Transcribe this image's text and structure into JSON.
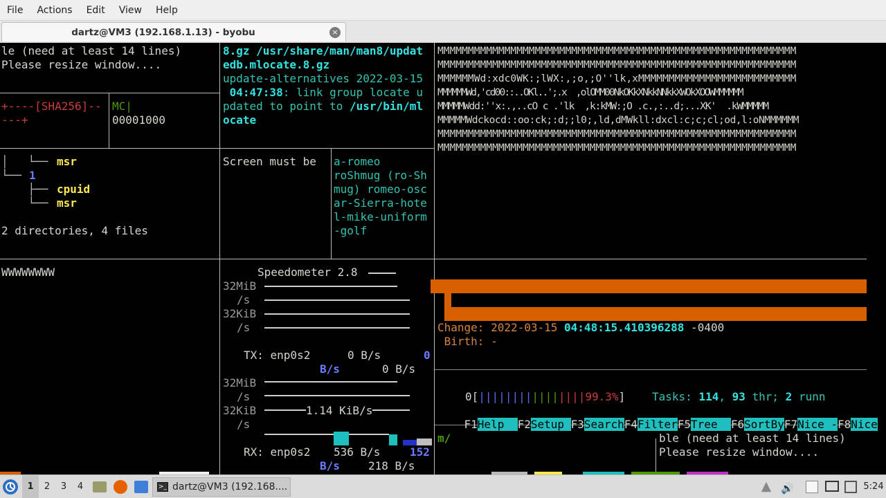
{
  "menubar": {
    "items": [
      "File",
      "Actions",
      "Edit",
      "View",
      "Help"
    ]
  },
  "tab": {
    "title": "dartz@VM3 (192.168.1.13) - byobu",
    "close": "×"
  },
  "pane1": {
    "line1": "le (need at least 14 lines)",
    "line2": "Please resize window....",
    "sha_line1": "+----[SHA256]--",
    "sha_line2": "---+",
    "mc_line1": "MC|",
    "mc_line2": "00001000"
  },
  "pane2": {
    "l1a": "8.gz ",
    "l1b": "/usr/share/man/man8/updat",
    "l2": "edb.mlocate.8.gz",
    "l3": "update-alternatives 2022-03-15",
    "l4a": " 04:47:38",
    "l4b": ": link group locate u",
    "l5a": "pdated to point to ",
    "l5b": "/usr/bin/ml",
    "l6": "ocate"
  },
  "pane3": {
    "rows": [
      "MMMMMMMMMMMMMMMMMMMMMMMMMMMMMMMMMMMMMMMMMMMMMMMMMMMMMMMMMMM",
      "MMMMMMMMMMMMMMMMMMMMMMMMMMMMMMMMMMMMMMMMMMMMMMMMMMMMMMMMMMM",
      "MMMMMMWd:xdc0WK:;lWX:,;o,;O''lk,xMMMMMMMMMMMMMMMMMMMMMMMMMM",
      "MMMMMMWd,'cd00::..OKl..';.x  ,olOMM00NkOKkXNkkNNkkXWOkXOOWMMMMMM",
      "MMMMMWdd:''x:.,..cO c .'lk  ,k:kMW:;O .c.,:..d;...XK'  .kWMMMMM",
      "MMMMMWdckocd::oo:ck;:d;;l0;,ld,dMWkll:dxcl:c;c;cl;od,l:oNMMMMMM",
      "MMMMMMMMMMMMMMMMMMMMMMMMMMMMMMMMMMMMMMMMMMMMMMMMMMMMMMMMMMM",
      "MMMMMMMMMMMMMMMMMMMMMMMMMMMMMMMMMMMMMMMMMMMMMMMMMMMMMMMMMMM"
    ]
  },
  "pane4": {
    "t1": "msr",
    "t2": "1",
    "t3": "cpuid",
    "t4": "msr",
    "summary": "2 directories, 4 files"
  },
  "pane5": {
    "text": "Screen must be"
  },
  "pane6": {
    "lines": [
      "a-romeo",
      "roShmug (ro-Sh",
      "mug) romeo-osc",
      "ar-Sierra-hote",
      "l-mike-uniform",
      "-golf"
    ]
  },
  "pane7": {
    "text": "WWWWWWWW"
  },
  "speedometer": {
    "title": "Speedometer 2.8",
    "scale1": "32MiB",
    "unit1": "/s",
    "scale2": "32KiB",
    "unit2": "/s",
    "tx_label": "TX: enp0s2",
    "tx_rate": "0 B/s",
    "tx_num": "0",
    "tx_unit": "B/s",
    "tx_rate2": "0 B/s",
    "scale3": "32MiB",
    "unit3": "/s",
    "scale4": "32KiB",
    "unit4": "/s",
    "rx_mid": "1.14 KiB/s",
    "rx_label": "RX: enp0s2",
    "rx_rate": "536 B/s",
    "rx_num": "152",
    "rx_unit": "B/s",
    "rx_rate2": "218 B/s"
  },
  "stat": {
    "change_label": "Change: 2022-03-15 ",
    "change_time": "04:48:15.410396288",
    "change_tz": " -0400",
    "birth": " Birth: -"
  },
  "htop": {
    "cpu_num": "0",
    "cpu_pct": "99.3%",
    "tasks_label": "Tasks: ",
    "tasks_n": "114",
    "thr_n": "93",
    "thr_label": " thr; ",
    "run_n": "2",
    "run_label": " runn",
    "fkeys": [
      {
        "k": "F1",
        "l": "Help  "
      },
      {
        "k": "F2",
        "l": "Setup "
      },
      {
        "k": "F3",
        "l": "Search"
      },
      {
        "k": "F4",
        "l": "Filter"
      },
      {
        "k": "F5",
        "l": "Tree  "
      },
      {
        "k": "F6",
        "l": "SortBy"
      },
      {
        "k": "F7",
        "l": "Nice -"
      },
      {
        "k": "F8",
        "l": "Nice"
      }
    ]
  },
  "cmd": {
    "prompt": "m/"
  },
  "pane_br": {
    "line1": "ble (need at least 14 lines)",
    "line2": "Please resize window...."
  },
  "taskbar": {
    "workspaces": [
      "1",
      "2",
      "3",
      "4"
    ],
    "task_label": "dartz@VM3 (192.168....",
    "time": "5:24"
  }
}
